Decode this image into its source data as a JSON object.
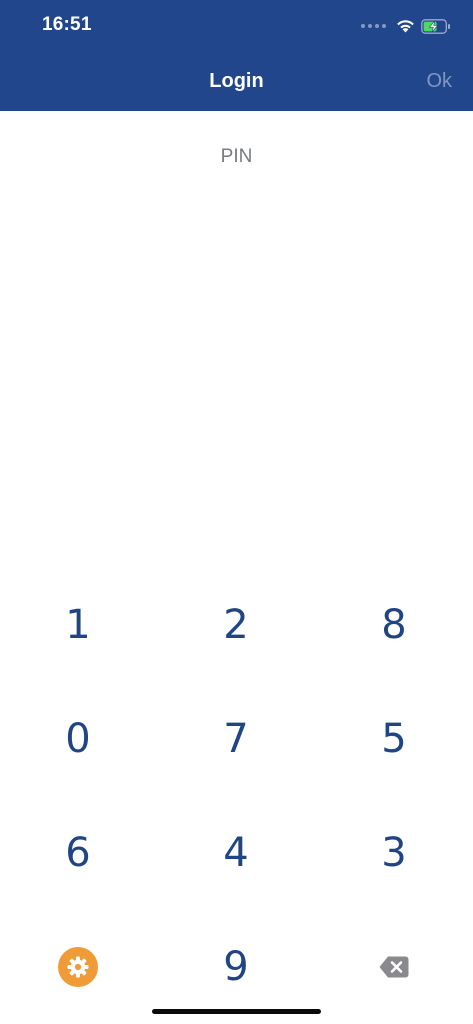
{
  "status_bar": {
    "time": "16:51",
    "icons": [
      "signal-dots-icon",
      "wifi-icon",
      "battery-charging-icon"
    ]
  },
  "nav": {
    "title": "Login",
    "ok_label": "Ok"
  },
  "pin": {
    "label": "PIN"
  },
  "keypad": {
    "rows": [
      [
        "1",
        "2",
        "8"
      ],
      [
        "0",
        "7",
        "5"
      ],
      [
        "6",
        "4",
        "3"
      ]
    ],
    "bottom": {
      "left_icon": "settings-gear-icon",
      "center": "9",
      "right_icon": "backspace-icon"
    }
  },
  "colors": {
    "nav_background": "#21468c",
    "key_text": "#1f4584",
    "settings_accent": "#ee9b38",
    "ok_disabled": "#7f97c2",
    "battery_fill": "#4cd964"
  }
}
